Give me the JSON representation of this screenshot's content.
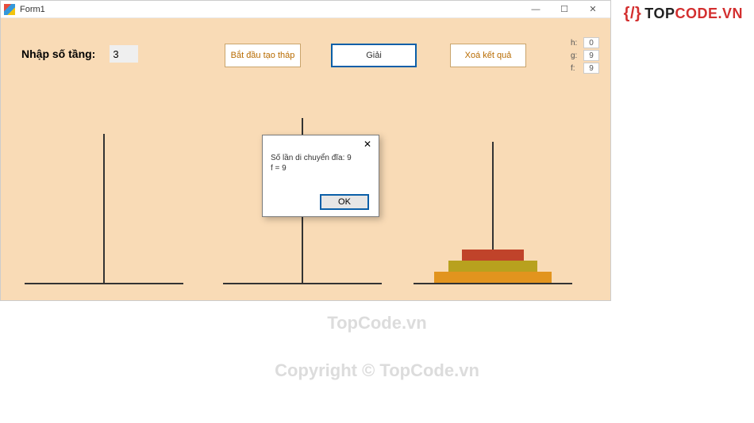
{
  "window": {
    "title": "Form1"
  },
  "controls": {
    "input_label": "Nhập số tầng:",
    "input_value": "3",
    "btn_start": "Bắt đầu tạo tháp",
    "btn_solve": "Giải",
    "btn_clear": "Xoá kết quả"
  },
  "stats": {
    "h_label": "h:",
    "h_value": "0",
    "g_label": "g:",
    "g_value": "9",
    "f_label": "f:",
    "f_value": "9"
  },
  "msgbox": {
    "line1": "Số lần di chuyển đĩa: 9",
    "line2": "f = 9",
    "ok": "OK"
  },
  "watermark": {
    "logo_left": "TOP",
    "logo_right": "CODE.VN",
    "wm1": "TopCode.vn",
    "wm2": "Copyright © TopCode.vn"
  },
  "towers": {
    "count": 3,
    "disks_on_c": [
      1,
      2,
      3
    ]
  }
}
